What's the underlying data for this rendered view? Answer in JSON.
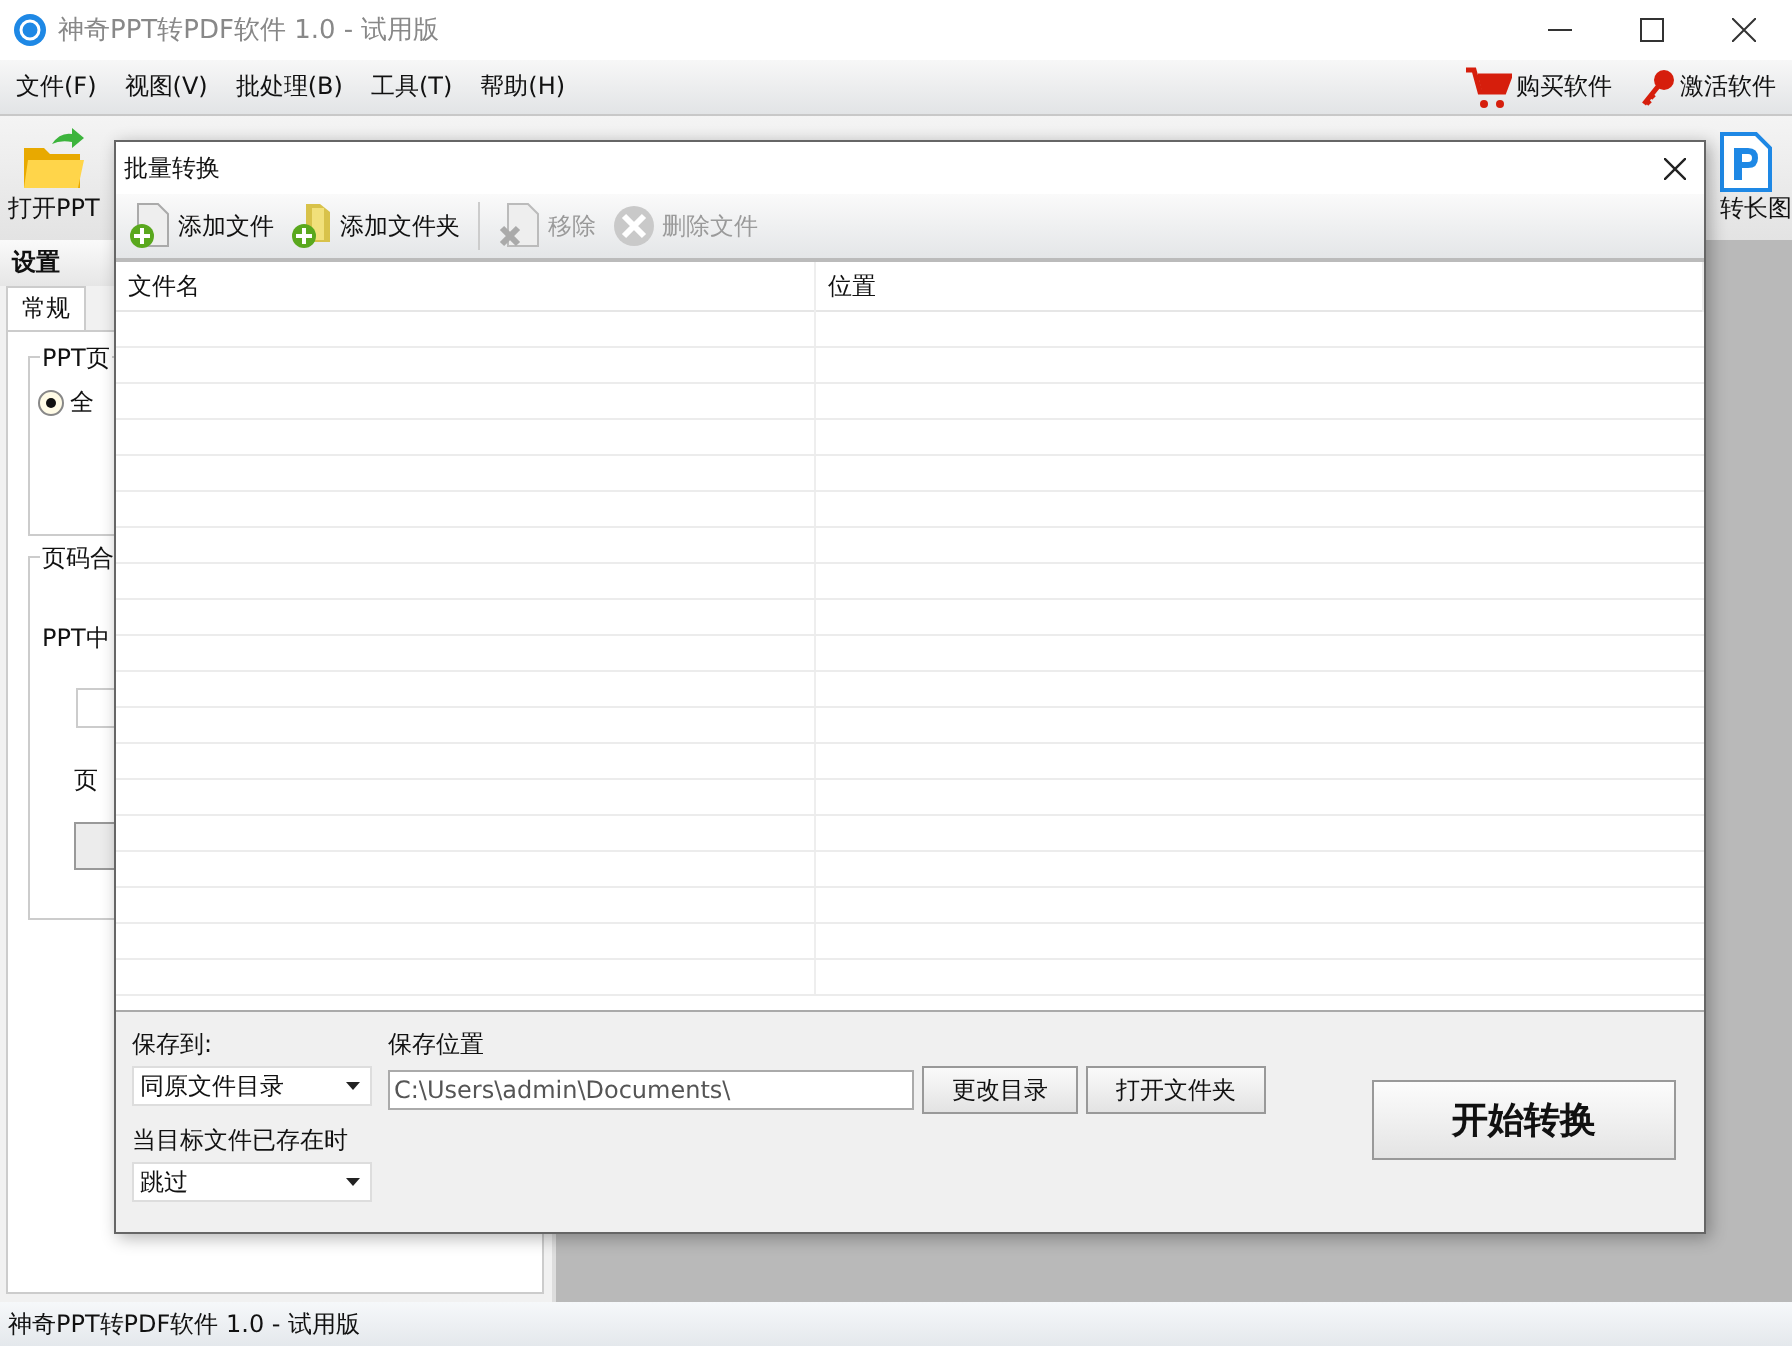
{
  "window": {
    "title": "神奇PPT转PDF软件 1.0 - 试用版"
  },
  "menu": [
    "文件(F)",
    "视图(V)",
    "批处理(B)",
    "工具(T)",
    "帮助(H)"
  ],
  "menu_right": [
    {
      "kind": "cart",
      "label": "购买软件"
    },
    {
      "kind": "key",
      "label": "激活软件"
    }
  ],
  "toolbar": {
    "left_label": "打开PPT",
    "right_label": "转长图"
  },
  "settings": {
    "title": "设置",
    "tabs": [
      {
        "label": "常规",
        "selected": true
      }
    ],
    "group_1": "PPT页",
    "radio": {
      "label": "全",
      "selected": true
    },
    "group_2": "页码合",
    "label_1": "PPT中",
    "label_2": "页"
  },
  "dialog": {
    "title": "批量转换",
    "tools": [
      {
        "kind": "file",
        "label": "添加文件",
        "disabled": false
      },
      {
        "kind": "folder",
        "label": "添加文件夹",
        "disabled": false
      },
      {
        "kind": "remove",
        "label": "移除",
        "disabled": true
      },
      {
        "kind": "delete",
        "label": "删除文件",
        "disabled": true
      }
    ],
    "columns": [
      "文件名",
      "位置"
    ],
    "save_to": {
      "label": "保存到:",
      "value": "同原文件目录"
    },
    "save_path": {
      "label": "保存位置",
      "value": "C:\\Users\\admin\\Documents\\"
    },
    "buttons": [
      "更改目录",
      "打开文件夹"
    ],
    "exists": {
      "label": "当目标文件已存在时",
      "value": "跳过"
    },
    "start": "开始转换"
  },
  "status_bar": "神奇PPT转PDF软件 1.0 - 试用版"
}
